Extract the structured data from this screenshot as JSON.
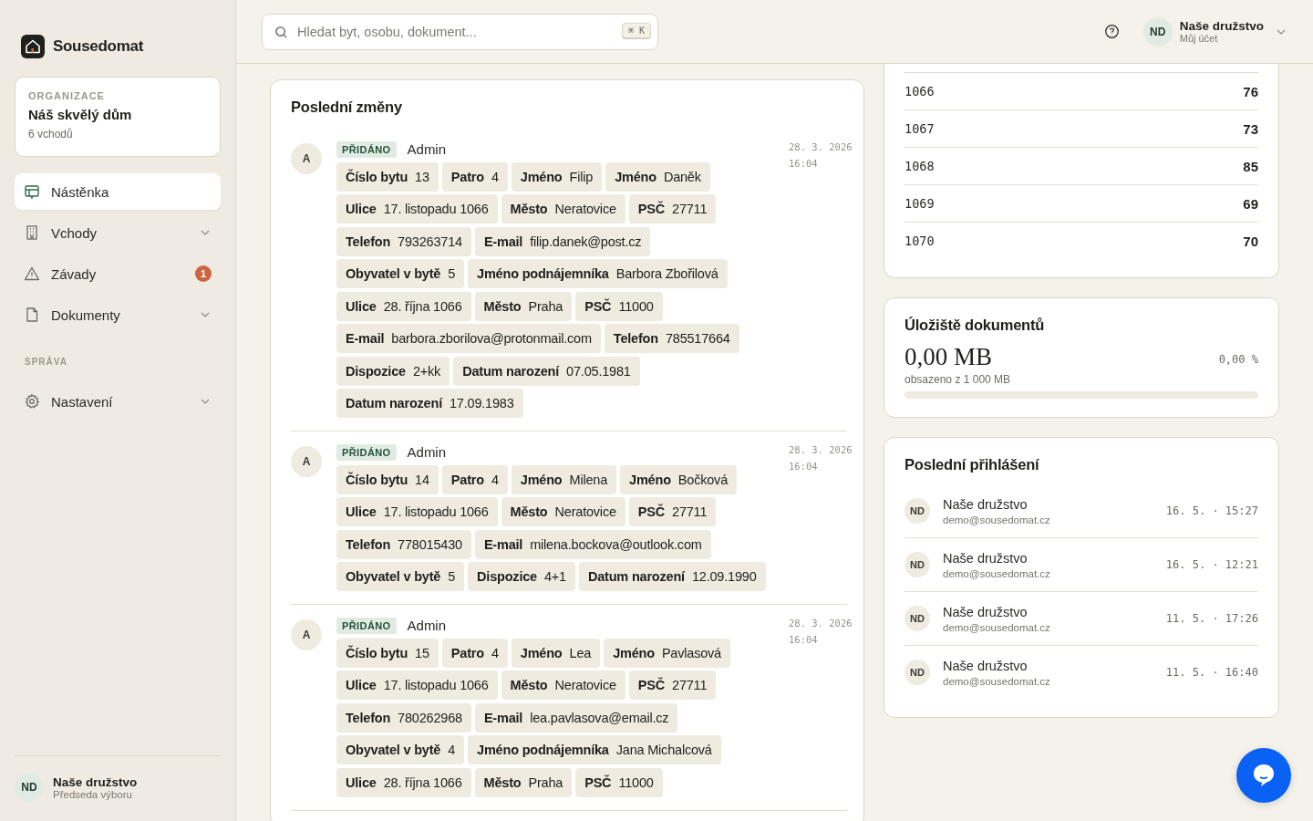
{
  "sidebar": {
    "brand": "Sousedomat",
    "organization": {
      "caption": "ORGANIZACE",
      "name": "Náš skvělý dům",
      "detail": "6 vchodů"
    },
    "items": [
      {
        "label": "Nástěnka",
        "selected": true,
        "expandable": false
      },
      {
        "label": "Vchody",
        "selected": false,
        "expandable": true
      },
      {
        "label": "Závady",
        "selected": false,
        "expandable": false,
        "badge": "1"
      },
      {
        "label": "Dokumenty",
        "selected": false,
        "expandable": true
      }
    ],
    "section_title": "SPRÁVA",
    "admin_items": [
      {
        "label": "Nastavení",
        "selected": false,
        "expandable": true
      }
    ],
    "user": {
      "initials": "ND",
      "name": "Naše družstvo",
      "role": "Předseda výboru"
    }
  },
  "header": {
    "search": {
      "placeholder": "Hledat byt, osobu, dokument...",
      "shortcut": "⌘ K"
    },
    "account": {
      "initials": "ND",
      "name": "Naše družstvo",
      "subtitle": "Můj účet"
    }
  },
  "recent_changes": {
    "title": "Poslední změny",
    "entries": [
      {
        "avatar": "A",
        "kind": "added",
        "badge": "PŘIDÁNO",
        "author": "Admin",
        "date": "28. 3. 2026",
        "time": "16:04",
        "fields": [
          {
            "label": "Číslo bytu",
            "value": "13"
          },
          {
            "label": "Patro",
            "value": "4"
          },
          {
            "label": "Jméno",
            "value": "Filip"
          },
          {
            "label": "Jméno",
            "value": "Daněk"
          },
          {
            "label": "Ulice",
            "value": "17. listopadu 1066"
          },
          {
            "label": "Město",
            "value": "Neratovice"
          },
          {
            "label": "PSČ",
            "value": "27711"
          },
          {
            "label": "Telefon",
            "value": "793263714"
          },
          {
            "label": "E-mail",
            "value": "filip.danek@post.cz"
          },
          {
            "label": "Obyvatel v bytě",
            "value": "5"
          },
          {
            "label": "Jméno podnájemníka",
            "value": "Barbora Zbořilová"
          },
          {
            "label": "Ulice",
            "value": "28. října 1066"
          },
          {
            "label": "Město",
            "value": "Praha"
          },
          {
            "label": "PSČ",
            "value": "11000"
          },
          {
            "label": "E-mail",
            "value": "barbora.zborilova@protonmail.com"
          },
          {
            "label": "Telefon",
            "value": "785517664"
          },
          {
            "label": "Dispozice",
            "value": "2+kk"
          },
          {
            "label": "Datum narození",
            "value": "07.05.1981"
          },
          {
            "label": "Datum narození",
            "value": "17.09.1983"
          }
        ]
      },
      {
        "avatar": "A",
        "kind": "added",
        "badge": "PŘIDÁNO",
        "author": "Admin",
        "date": "28. 3. 2026",
        "time": "16:04",
        "fields": [
          {
            "label": "Číslo bytu",
            "value": "14"
          },
          {
            "label": "Patro",
            "value": "4"
          },
          {
            "label": "Jméno",
            "value": "Milena"
          },
          {
            "label": "Jméno",
            "value": "Bočková"
          },
          {
            "label": "Ulice",
            "value": "17. listopadu 1066"
          },
          {
            "label": "Město",
            "value": "Neratovice"
          },
          {
            "label": "PSČ",
            "value": "27711"
          },
          {
            "label": "Telefon",
            "value": "778015430"
          },
          {
            "label": "E-mail",
            "value": "milena.bockova@outlook.com"
          },
          {
            "label": "Obyvatel v bytě",
            "value": "5"
          },
          {
            "label": "Dispozice",
            "value": "4+1"
          },
          {
            "label": "Datum narození",
            "value": "12.09.1990"
          }
        ]
      },
      {
        "avatar": "A",
        "kind": "added",
        "badge": "PŘIDÁNO",
        "author": "Admin",
        "date": "28. 3. 2026",
        "time": "16:04",
        "fields": [
          {
            "label": "Číslo bytu",
            "value": "15"
          },
          {
            "label": "Patro",
            "value": "4"
          },
          {
            "label": "Jméno",
            "value": "Lea"
          },
          {
            "label": "Jméno",
            "value": "Pavlasová"
          },
          {
            "label": "Ulice",
            "value": "17. listopadu 1066"
          },
          {
            "label": "Město",
            "value": "Neratovice"
          },
          {
            "label": "PSČ",
            "value": "27711"
          },
          {
            "label": "Telefon",
            "value": "780262968"
          },
          {
            "label": "E-mail",
            "value": "lea.pavlasova@email.cz"
          },
          {
            "label": "Obyvatel v bytě",
            "value": "4"
          },
          {
            "label": "Jméno podnájemníka",
            "value": "Jana Michalcová"
          },
          {
            "label": "Ulice",
            "value": "28. října 1066"
          },
          {
            "label": "Město",
            "value": "Praha"
          },
          {
            "label": "PSČ",
            "value": "11000"
          }
        ]
      }
    ]
  },
  "buildings_table": {
    "rows": [
      {
        "number": "1066",
        "count": "76"
      },
      {
        "number": "1067",
        "count": "73"
      },
      {
        "number": "1068",
        "count": "85"
      },
      {
        "number": "1069",
        "count": "69"
      },
      {
        "number": "1070",
        "count": "70"
      }
    ]
  },
  "storage": {
    "title": "Úložiště dokumentů",
    "used": "0,00 MB",
    "percent": "0,00 %",
    "caption": "obsazeno z 1 000 MB",
    "level": 0
  },
  "recent_logins": {
    "title": "Poslední přihlášení",
    "items": [
      {
        "initials": "ND",
        "name": "Naše družstvo",
        "email": "demo@sousedomat.cz",
        "time": "16. 5. · 15:27"
      },
      {
        "initials": "ND",
        "name": "Naše družstvo",
        "email": "demo@sousedomat.cz",
        "time": "16. 5. · 12:21"
      },
      {
        "initials": "ND",
        "name": "Naše družstvo",
        "email": "demo@sousedomat.cz",
        "time": "11. 5. · 17:26"
      },
      {
        "initials": "ND",
        "name": "Naše družstvo",
        "email": "demo@sousedomat.cz",
        "time": "11. 5. · 16:40"
      }
    ]
  }
}
